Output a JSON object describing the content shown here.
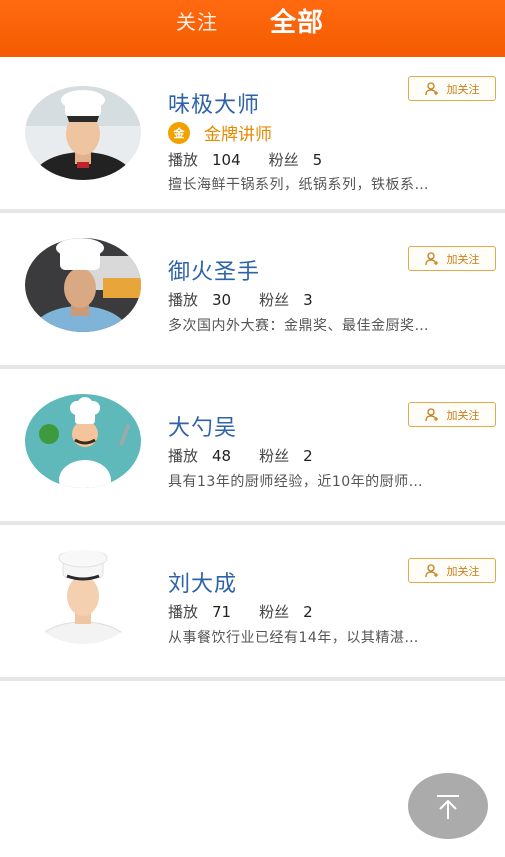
{
  "header": {
    "tab_follow": "关注",
    "tab_all": "全部"
  },
  "chefs": [
    {
      "name": "味极大师",
      "badge": "金牌讲师",
      "badge_icon_text": "金",
      "plays_label": "播放",
      "plays": "104",
      "fans_label": "粉丝",
      "fans": "5",
      "description": "擅长海鲜干锅系列，纸锅系列，铁板系…",
      "follow_label": "加关注"
    },
    {
      "name": "御火圣手",
      "plays_label": "播放",
      "plays": "30",
      "fans_label": "粉丝",
      "fans": "3",
      "description": "多次国内外大赛：金鼎奖、最佳金厨奖…",
      "follow_label": "加关注"
    },
    {
      "name": "大勺吴",
      "plays_label": "播放",
      "plays": "48",
      "fans_label": "粉丝",
      "fans": "2",
      "description": "具有13年的厨师经验，近10年的厨师…",
      "follow_label": "加关注"
    },
    {
      "name": "刘大成",
      "plays_label": "播放",
      "plays": "71",
      "fans_label": "粉丝",
      "fans": "2",
      "description": "从事餐饮行业已经有14年，以其精湛…",
      "follow_label": "加关注"
    }
  ],
  "icons": {
    "follow": "user-plus-icon",
    "back_to_top": "arrow-up-icon",
    "badge": "gold-medal-icon"
  },
  "colors": {
    "header": "#f55b00",
    "name": "#2f63a8",
    "badge": "#e68a00",
    "follow_border": "#e0a94a"
  }
}
